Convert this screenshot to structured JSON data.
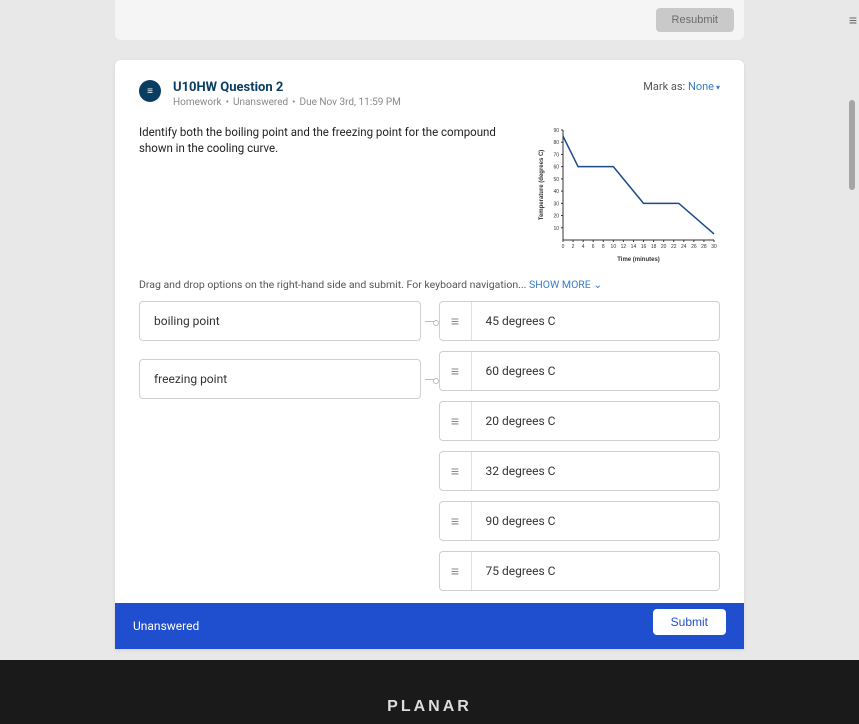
{
  "topbar": {
    "resubmit_label": "Resubmit"
  },
  "header": {
    "title": "U10HW Question 2",
    "type": "Homework",
    "status": "Unanswered",
    "due": "Due Nov 3rd, 11:59 PM",
    "mark_as_label": "Mark as:",
    "mark_as_value": "None"
  },
  "prompt": "Identify both the boiling point and the freezing point for the compound shown in the cooling curve.",
  "instruction": {
    "text": "Drag and drop options on the right-hand side and submit. For keyboard navigation... ",
    "show_more": "SHOW MORE"
  },
  "targets": [
    {
      "label": "boiling point"
    },
    {
      "label": "freezing point"
    }
  ],
  "options": [
    {
      "label": "45 degrees C"
    },
    {
      "label": "60 degrees C"
    },
    {
      "label": "20 degrees C"
    },
    {
      "label": "32 degrees C"
    },
    {
      "label": "90 degrees C"
    },
    {
      "label": "75 degrees C"
    }
  ],
  "footer": {
    "status": "Unanswered",
    "submit_label": "Submit"
  },
  "brand": "PLANAR",
  "chart_data": {
    "type": "line",
    "title": "",
    "xlabel": "Time (minutes)",
    "ylabel": "Temperature (degrees C)",
    "xlim": [
      0,
      30
    ],
    "ylim": [
      0,
      90
    ],
    "x_ticks": [
      0,
      2,
      4,
      6,
      8,
      10,
      12,
      14,
      16,
      18,
      20,
      22,
      24,
      26,
      28,
      30
    ],
    "y_ticks": [
      10,
      20,
      30,
      40,
      50,
      60,
      70,
      80,
      90
    ],
    "x": [
      0,
      3,
      10,
      16,
      23,
      30
    ],
    "y": [
      85,
      60,
      60,
      30,
      30,
      5
    ]
  }
}
